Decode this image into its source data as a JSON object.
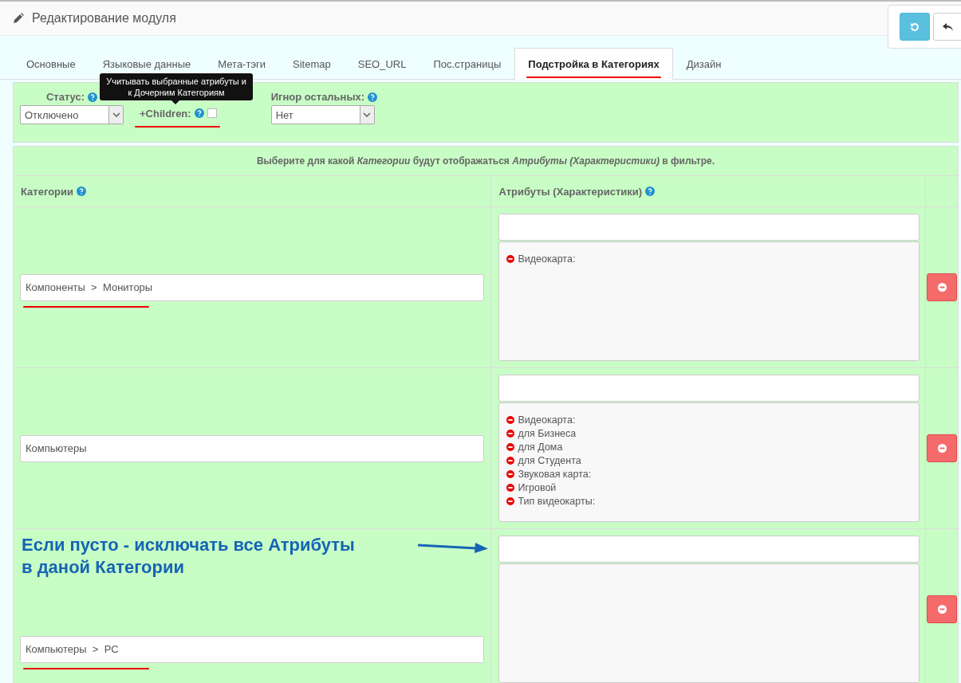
{
  "header": {
    "title": "Редактирование модуля"
  },
  "tabs": [
    {
      "label": "Основные",
      "selected": false
    },
    {
      "label": "Языковые данные",
      "selected": false
    },
    {
      "label": "Мета-тэги",
      "selected": false
    },
    {
      "label": "Sitemap",
      "selected": false
    },
    {
      "label": "SEO_URL",
      "selected": false
    },
    {
      "label": "Пос.страницы",
      "selected": false
    },
    {
      "label": "Подстройка в Категориях",
      "selected": true,
      "underlined": true
    },
    {
      "label": "Дизайн",
      "selected": false
    }
  ],
  "settings": {
    "status": {
      "label": "Статус:",
      "value": "Отключено"
    },
    "children": {
      "label": "+Children:",
      "checked": false,
      "underlined": true,
      "tooltip": "Учитывать выбранные атрибуты и к Дочерним Категориям"
    },
    "ignore": {
      "label": "Игнор остальных:",
      "value": "Нет"
    }
  },
  "table": {
    "caption": "Выберите для какой *Категории* будут отображаться *Атрибуты (Характеристики)* в фильтре.",
    "columns": [
      "Категории",
      "Атрибуты (Характеристики)"
    ],
    "rows": [
      {
        "category": "Компоненты  >  Мониторы",
        "underlined": true,
        "attributes": [
          "Видеокарта:"
        ]
      },
      {
        "category": "Компьютеры",
        "underlined": false,
        "attributes": [
          "Видеокарта:",
          "для Бизнеса",
          "для Дома",
          "для Студента",
          "Звуковая карта:",
          "Игровой",
          "Тип видеокарты:"
        ]
      },
      {
        "category": "Компьютеры  >  PC",
        "underlined": true,
        "attributes": [],
        "note": [
          "Если пусто - исключать все Атрибуты",
          "в даной Категории"
        ]
      }
    ]
  }
}
